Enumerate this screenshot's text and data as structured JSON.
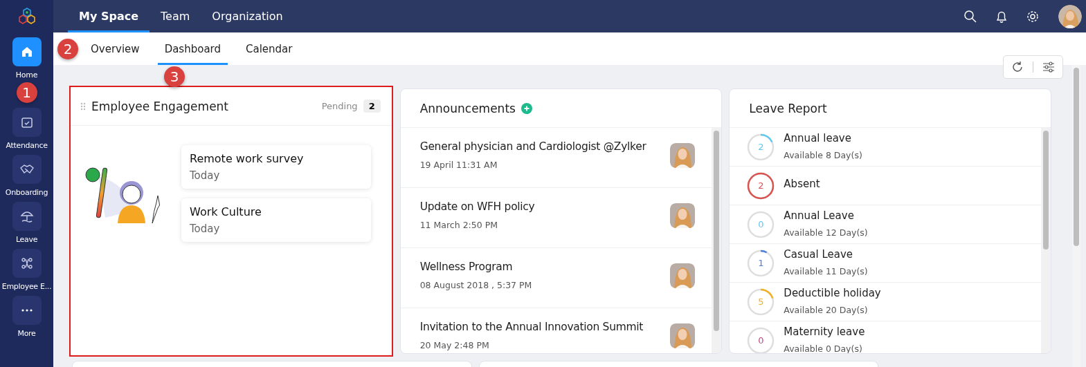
{
  "sidebar": {
    "items": [
      {
        "label": "Home",
        "selected": true
      },
      {
        "label": "Attendance",
        "selected": false
      },
      {
        "label": "Onboarding",
        "selected": false
      },
      {
        "label": "Leave",
        "selected": false
      },
      {
        "label": "Employee E...",
        "selected": false
      },
      {
        "label": "More",
        "selected": false
      }
    ]
  },
  "top_tabs": [
    {
      "label": "My Space",
      "selected": true
    },
    {
      "label": "Team",
      "selected": false
    },
    {
      "label": "Organization",
      "selected": false
    }
  ],
  "sub_tabs": [
    {
      "label": "Overview",
      "selected": false
    },
    {
      "label": "Dashboard",
      "selected": true
    },
    {
      "label": "Calendar",
      "selected": false
    }
  ],
  "callouts": [
    "1",
    "2",
    "3"
  ],
  "engagement": {
    "title": "Employee Engagement",
    "pending_label": "Pending",
    "pending_count": "2",
    "highlighted": true,
    "surveys": [
      {
        "title": "Remote work survey",
        "date": "Today"
      },
      {
        "title": "Work Culture",
        "date": "Today"
      }
    ]
  },
  "announcements": {
    "title": "Announcements",
    "items": [
      {
        "title": "General physician and Cardiologist @Zylker",
        "date": "19 April 11:31 AM"
      },
      {
        "title": "Update on WFH policy",
        "date": "11 March 2:50 PM"
      },
      {
        "title": "Wellness Program",
        "date": "08 August 2018 , 5:37 PM"
      },
      {
        "title": "Invitation to the Annual Innovation Summit",
        "date": "20 May 2:48 PM"
      }
    ]
  },
  "leave_report": {
    "title": "Leave Report",
    "items": [
      {
        "count": "2",
        "name": "Annual leave",
        "available": "Available 8 Day(s)",
        "level": 0.18,
        "color": "#5bc8f0"
      },
      {
        "count": "2",
        "name": "Absent",
        "level": 1,
        "color": "#d9534f"
      },
      {
        "count": "0",
        "name": "Annual Leave",
        "available": "Available 12 Day(s)",
        "level": 0,
        "color": "#5bc8f0"
      },
      {
        "count": "1",
        "name": "Casual Leave",
        "available": "Available 11 Day(s)",
        "level": 0.08,
        "color": "#4a7fe0"
      },
      {
        "count": "5",
        "name": "Deductible holiday",
        "available": "Available 20 Day(s)",
        "level": 0.2,
        "color": "#f0b020"
      },
      {
        "count": "0",
        "name": "Maternity leave",
        "available": "Available 0 Day(s)",
        "level": 0,
        "color": "#c04a8a"
      }
    ]
  }
}
